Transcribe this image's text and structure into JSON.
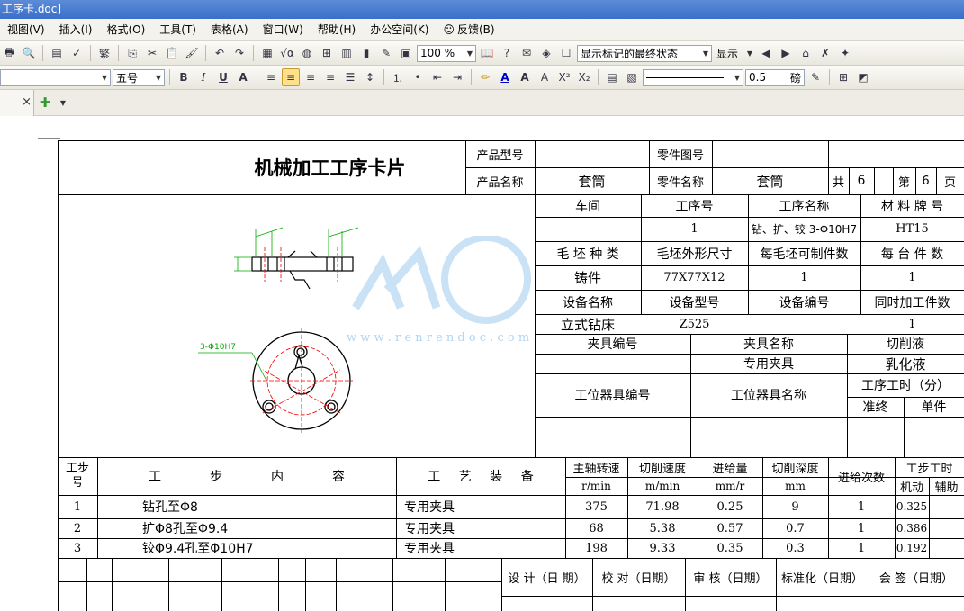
{
  "window": {
    "title": "工序卡.doc]"
  },
  "menu": [
    {
      "label": "视图(V)"
    },
    {
      "label": "插入(I)"
    },
    {
      "label": "格式(O)"
    },
    {
      "label": "工具(T)"
    },
    {
      "label": "表格(A)"
    },
    {
      "label": "窗口(W)"
    },
    {
      "label": "帮助(H)"
    },
    {
      "label": "办公空间(K)"
    },
    {
      "label": "反馈(B)"
    }
  ],
  "toolbar": {
    "zoom": "100 %",
    "markup_mode": "显示标记的最终状态",
    "show_label": "显示",
    "font_size": "五号",
    "line_weight": "0.5",
    "line_unit": "磅"
  },
  "card": {
    "title": "机械加工工序卡片",
    "product_model_label": "产品型号",
    "product_name_label": "产品名称",
    "product_name": "套筒",
    "part_drawing_label": "零件图号",
    "part_name_label": "零件名称",
    "part_name": "套筒",
    "total_label": "共",
    "total": "6",
    "page_label": "第",
    "page": "6",
    "page_unit": "页",
    "workshop_label": "车间",
    "op_no_label": "工序号",
    "op_name_label": "工序名称",
    "material_label": "材 料 牌 号",
    "op_no": "1",
    "op_name": "钻、扩、铰 3-Φ10H7",
    "material": "HT15",
    "blank_type_label": "毛 坯 种 类",
    "blank_size_label": "毛坯外形尺寸",
    "per_blank_label": "每毛坯可制件数",
    "per_unit_label": "每 台 件 数",
    "blank_type": "铸件",
    "blank_size": "77X77X12",
    "per_blank": "1",
    "per_unit": "1",
    "equip_name_label": "设备名称",
    "equip_model_label": "设备型号",
    "equip_no_label": "设备编号",
    "simul_label": "同时加工件数",
    "equip_name": "立式钻床",
    "equip_model": "Z525",
    "simul": "1",
    "fixture_no_label": "夹具编号",
    "fixture_name_label": "夹具名称",
    "coolant_label": "切削液",
    "fixture_name": "专用夹具",
    "coolant": "乳化液",
    "station_no_label": "工位器具编号",
    "station_name_label": "工位器具名称",
    "op_time_label": "工序工时（分）",
    "prep_label": "准终",
    "unit_label": "单件",
    "drawing_dim_label": "3-Φ10H7"
  },
  "steps_header": {
    "step_no": "工步号",
    "content": [
      "工",
      "步",
      "内",
      "容"
    ],
    "equipment": [
      "工",
      "艺",
      "装",
      "备"
    ],
    "spindle": "主轴转速",
    "spindle_unit": "r/min",
    "speed": "切削速度",
    "speed_unit": "m/min",
    "feed": "进给量",
    "feed_unit": "mm/r",
    "depth": "切削深度",
    "depth_unit": "mm",
    "passes": "进给次数",
    "time": "工步工时",
    "time_machine": "机动",
    "time_aux": "辅助"
  },
  "steps": [
    {
      "no": "1",
      "content": "钻孔至Φ8",
      "equip": "专用夹具",
      "rpm": "375",
      "speed": "71.98",
      "feed": "0.25",
      "depth": "9",
      "passes": "1",
      "time": "0.325"
    },
    {
      "no": "2",
      "content": "扩Φ8孔至Φ9.4",
      "equip": "专用夹具",
      "rpm": "68",
      "speed": "5.38",
      "feed": "0.57",
      "depth": "0.7",
      "passes": "1",
      "time": "0.386"
    },
    {
      "no": "3",
      "content": "铰Φ9.4孔至Φ10H7",
      "equip": "专用夹具",
      "rpm": "198",
      "speed": "9.33",
      "feed": "0.35",
      "depth": "0.3",
      "passes": "1",
      "time": "0.192"
    }
  ],
  "signoff": [
    {
      "label": "设 计（日 期）"
    },
    {
      "label": "校 对（日期）"
    },
    {
      "label": "审 核（日期）"
    },
    {
      "label": "标准化（日期）"
    },
    {
      "label": "会 签（日期）"
    }
  ],
  "watermark": {
    "url": "w w w . r e n r e n d o c . c o m"
  }
}
